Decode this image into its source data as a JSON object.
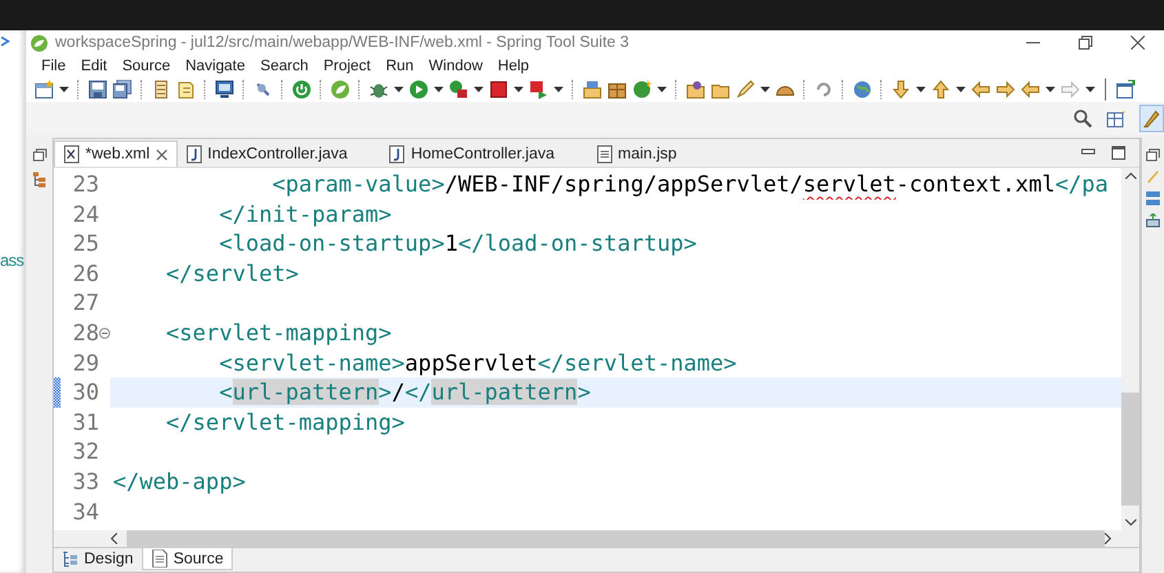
{
  "background_text": "ass",
  "window": {
    "title": "workspaceSpring - jul12/src/main/webapp/WEB-INF/web.xml - Spring Tool Suite 3"
  },
  "menu": [
    "File",
    "Edit",
    "Source",
    "Navigate",
    "Search",
    "Project",
    "Run",
    "Window",
    "Help"
  ],
  "editor_tabs": [
    {
      "label": "*web.xml",
      "kind": "xml",
      "selected": true
    },
    {
      "label": "IndexController.java",
      "kind": "java",
      "selected": false
    },
    {
      "label": "HomeController.java",
      "kind": "java",
      "selected": false
    },
    {
      "label": "main.jsp",
      "kind": "jsp",
      "selected": false
    }
  ],
  "code_lines": [
    {
      "number": "23",
      "current": false,
      "changed": false,
      "foldable": false,
      "segments": [
        {
          "kind": "tag",
          "text": "            <param-value>"
        },
        {
          "kind": "text",
          "text": "/WEB-INF/spring/appServlet/"
        },
        {
          "kind": "misspelled",
          "text": "servlet"
        },
        {
          "kind": "text",
          "text": "-context.xml"
        },
        {
          "kind": "tag",
          "text": "</pa"
        }
      ]
    },
    {
      "number": "24",
      "current": false,
      "changed": false,
      "foldable": false,
      "segments": [
        {
          "kind": "tag",
          "text": "        </init-param>"
        }
      ]
    },
    {
      "number": "25",
      "current": false,
      "changed": false,
      "foldable": false,
      "segments": [
        {
          "kind": "tag",
          "text": "        <load-on-startup>"
        },
        {
          "kind": "text",
          "text": "1"
        },
        {
          "kind": "tag",
          "text": "</load-on-startup>"
        }
      ]
    },
    {
      "number": "26",
      "current": false,
      "changed": false,
      "foldable": false,
      "segments": [
        {
          "kind": "tag",
          "text": "    </servlet>"
        }
      ]
    },
    {
      "number": "27",
      "current": false,
      "changed": false,
      "foldable": false
    },
    {
      "number": "28",
      "current": false,
      "changed": false,
      "foldable": true,
      "segments": [
        {
          "kind": "tag",
          "text": "    <servlet-mapping>"
        }
      ]
    },
    {
      "number": "29",
      "current": false,
      "changed": false,
      "foldable": false,
      "segments": [
        {
          "kind": "tag",
          "text": "        <servlet-name>"
        },
        {
          "kind": "text",
          "text": "appServlet"
        },
        {
          "kind": "tag",
          "text": "</servlet-name>"
        }
      ]
    },
    {
      "number": "30",
      "current": true,
      "changed": true,
      "foldable": false,
      "segments": [
        {
          "kind": "tag",
          "text": "        <"
        },
        {
          "kind": "occurrence",
          "text": "url-pattern"
        },
        {
          "kind": "tag",
          "text": ">"
        },
        {
          "kind": "text",
          "text": "/"
        },
        {
          "kind": "tag",
          "text": "</"
        },
        {
          "kind": "occurrence",
          "text": "url-pattern"
        },
        {
          "kind": "tag",
          "text": ">"
        }
      ]
    },
    {
      "number": "31",
      "current": false,
      "changed": false,
      "foldable": false,
      "segments": [
        {
          "kind": "tag",
          "text": "    </servlet-mapping>"
        }
      ]
    },
    {
      "number": "32",
      "current": false,
      "changed": false,
      "foldable": false
    },
    {
      "number": "33",
      "current": false,
      "changed": false,
      "foldable": false,
      "segments": [
        {
          "kind": "tag",
          "text": "</web-app>"
        }
      ]
    },
    {
      "number": "34",
      "current": false,
      "changed": false,
      "foldable": false
    }
  ],
  "bottom_tabs": [
    {
      "label": "Design",
      "kind": "design",
      "selected": false
    },
    {
      "label": "Source",
      "kind": "source",
      "selected": true
    }
  ]
}
